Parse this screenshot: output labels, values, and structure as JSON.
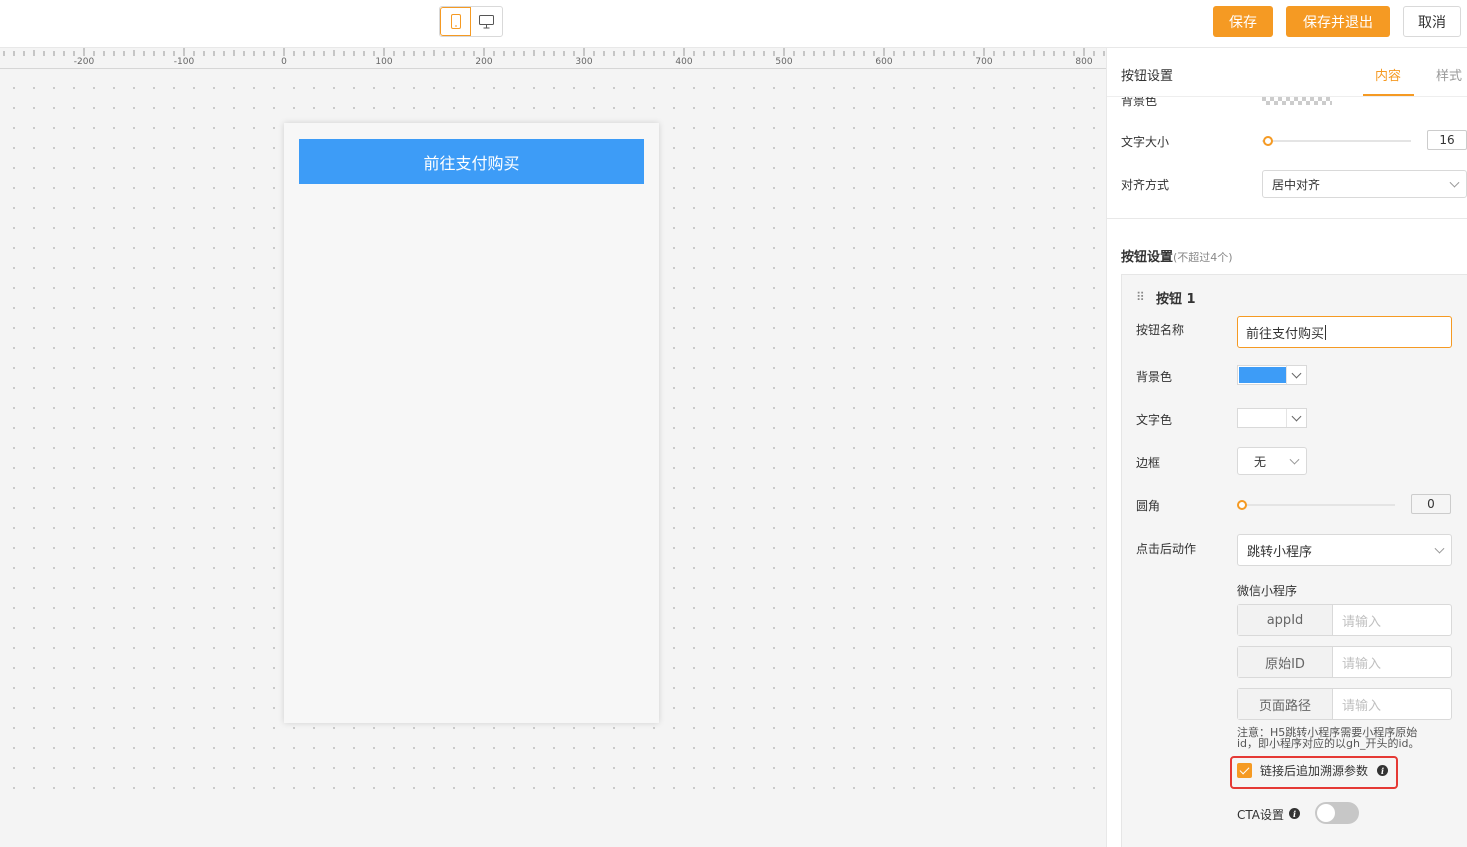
{
  "toolbar": {
    "save_label": "保存",
    "save_exit_label": "保存并退出",
    "cancel_label": "取消",
    "accent_color": "#f59a23"
  },
  "ruler": {
    "ticks": [
      "-200",
      "-100",
      "0",
      "100",
      "200",
      "300",
      "400",
      "500",
      "600",
      "700",
      "800"
    ]
  },
  "preview": {
    "button_text": "前往支付购买",
    "button_bg": "#3d9cf7",
    "button_color": "#ffffff"
  },
  "panel": {
    "title": "按钮设置",
    "tabs": [
      "内容",
      "样式"
    ],
    "active_tab": "内容",
    "cut_label": "背景色",
    "font_size_label": "文字大小",
    "font_size_value": "16",
    "align_label": "对齐方式",
    "align_value": "居中对齐",
    "section_title": "按钮设置",
    "section_hint": "(不超过4个)",
    "button_card": {
      "title": "按钮 1",
      "name_label": "按钮名称",
      "name_value": "前往支付购买",
      "bg_label": "背景色",
      "bg_color": "#3d9cf7",
      "text_color_label": "文字色",
      "text_color": "#ffffff",
      "border_label": "边框",
      "border_value": "无",
      "radius_label": "圆角",
      "radius_value": "0",
      "action_label": "点击后动作",
      "action_value": "跳转小程序",
      "mini_program_label": "微信小程序",
      "fields": [
        {
          "addon": "appId",
          "placeholder": "请输入"
        },
        {
          "addon": "原始ID",
          "placeholder": "请输入"
        },
        {
          "addon": "页面路径",
          "placeholder": "请输入"
        }
      ],
      "note": "注意：H5跳转小程序需要小程序原始id，即小程序对应的以gh_开头的id。",
      "append_param_label": "链接后追加溯源参数",
      "append_param_checked": true,
      "cta_label": "CTA设置",
      "cta_enabled": false
    }
  }
}
